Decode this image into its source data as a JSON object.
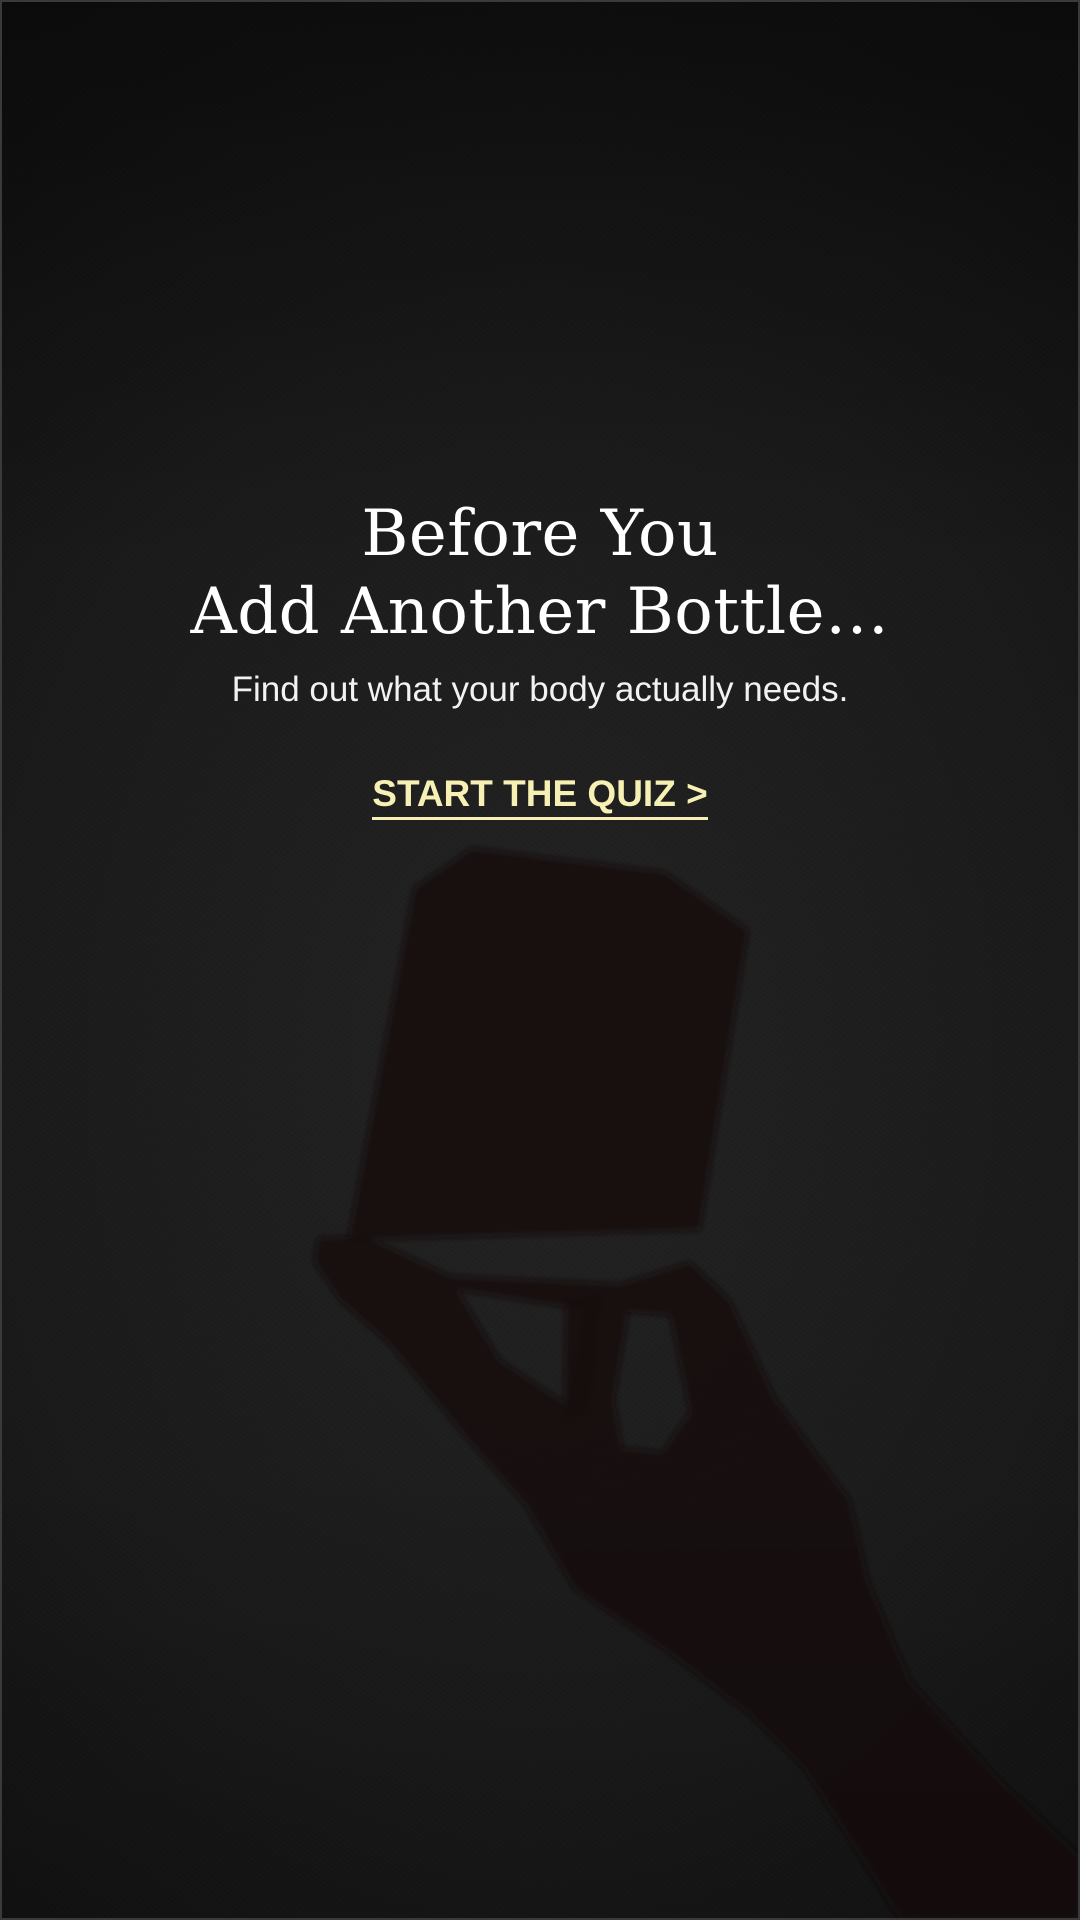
{
  "hero": {
    "headline_line1": "Before You",
    "headline_line2": "Add Another Bottle…",
    "subheadline": "Find out what your body actually needs.",
    "cta_label": "START THE QUIZ >"
  },
  "colors": {
    "background": "#1c1c1c",
    "headline": "#ffffff",
    "cta": "#f6f0b4",
    "silhouette": "#170b0d"
  },
  "icons": {
    "silhouette": "hand-holding-bottle-shadow"
  }
}
